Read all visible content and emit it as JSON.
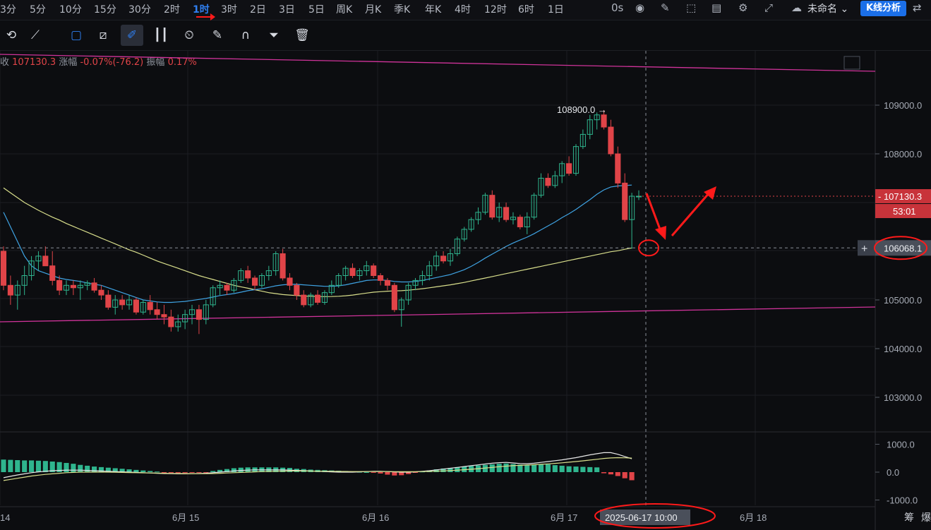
{
  "timeframes": [
    {
      "label": "3分",
      "active": false
    },
    {
      "label": "5分",
      "active": false
    },
    {
      "label": "10分",
      "active": false
    },
    {
      "label": "15分",
      "active": false
    },
    {
      "label": "30分",
      "active": false
    },
    {
      "label": "2时",
      "active": false
    },
    {
      "label": "1时",
      "active": true
    },
    {
      "label": "3时",
      "active": false
    },
    {
      "label": "2日",
      "active": false
    },
    {
      "label": "3日",
      "active": false
    },
    {
      "label": "5日",
      "active": false
    },
    {
      "label": "周K",
      "active": false
    },
    {
      "label": "月K",
      "active": false
    },
    {
      "label": "季K",
      "active": false
    },
    {
      "label": "年K",
      "active": false
    },
    {
      "label": "4时",
      "active": false
    },
    {
      "label": "12时",
      "active": false
    },
    {
      "label": "6时",
      "active": false
    },
    {
      "label": "1日",
      "active": false
    }
  ],
  "topbar": {
    "latency": "0s",
    "workspace": "未命名",
    "analysis_button": "K线分析"
  },
  "tools": [
    "sync-icon",
    "line-tool-icon",
    "rectangle-tool-icon",
    "ruler-icon",
    "brush-icon",
    "candles-icon",
    "timer-icon",
    "note-icon",
    "magnet-icon",
    "filter-icon",
    "trash-icon"
  ],
  "ohlc": {
    "close_label": "收",
    "close": "107130.3",
    "change_label": "涨幅",
    "change": "-0.07%(-76.2)",
    "amp_label": "振幅",
    "amp": "0.17%"
  },
  "price_axis": {
    "ticks": [
      "109000.0",
      "108000.0",
      "105000.0",
      "104000.0",
      "103000.0"
    ]
  },
  "last_price": {
    "value": "107130.3",
    "countdown": "53:01"
  },
  "crosshair_price": "106068.1",
  "crosshair_time": "2025-06-17 10:00",
  "high_marker": "108900.0 →",
  "indicator_axis": {
    "ticks": [
      "1000.0",
      "0.0",
      "-1000.0"
    ]
  },
  "x_axis": {
    "labels": [
      "14",
      "6月 15",
      "6月 16",
      "6月 17",
      "6月 18"
    ]
  },
  "bottom_right": [
    "筹",
    "爆"
  ],
  "colors": {
    "up": "#2fb58e",
    "down": "#e04448",
    "ma_fast": "#3fa3e3",
    "ma_slow": "#d9df8c",
    "channel": "#d0339a",
    "annotation": "#ff1a1a",
    "accent": "#2f7ff0"
  },
  "chart_data": {
    "type": "candlestick",
    "interval": "1h",
    "ylim": [
      102900,
      109900
    ],
    "x_labels": [
      "14",
      "6月 15",
      "6月 16",
      "6月 17",
      "6月 18"
    ],
    "candles": [
      [
        106000,
        106100,
        105200,
        105300
      ],
      [
        105300,
        105500,
        104900,
        105100
      ],
      [
        105100,
        105400,
        104800,
        105300
      ],
      [
        105300,
        105700,
        105100,
        105500
      ],
      [
        105500,
        105900,
        105400,
        105800
      ],
      [
        105800,
        106000,
        105600,
        105900
      ],
      [
        105900,
        106100,
        105700,
        105700
      ],
      [
        105700,
        106000,
        105300,
        105400
      ],
      [
        105400,
        105500,
        105100,
        105200
      ],
      [
        105200,
        105400,
        105100,
        105300
      ],
      [
        105300,
        105400,
        105100,
        105250
      ],
      [
        105250,
        105400,
        105000,
        105300
      ],
      [
        105300,
        105400,
        105200,
        105350
      ],
      [
        105350,
        105450,
        105150,
        105200
      ],
      [
        105200,
        105300,
        105000,
        105100
      ],
      [
        105100,
        105200,
        104800,
        104850
      ],
      [
        104850,
        105100,
        104700,
        105000
      ],
      [
        105000,
        105100,
        104800,
        104900
      ],
      [
        104900,
        105100,
        104800,
        105000
      ],
      [
        105000,
        105050,
        104700,
        104750
      ],
      [
        104750,
        105000,
        104700,
        104950
      ],
      [
        104950,
        105100,
        104700,
        104800
      ],
      [
        104800,
        104950,
        104600,
        104700
      ],
      [
        104700,
        104900,
        104500,
        104650
      ],
      [
        104650,
        104800,
        104350,
        104450
      ],
      [
        104450,
        104700,
        104350,
        104550
      ],
      [
        104550,
        104800,
        104400,
        104700
      ],
      [
        104700,
        104900,
        104500,
        104800
      ],
      [
        104800,
        104900,
        104300,
        104600
      ],
      [
        104600,
        105000,
        104500,
        104900
      ],
      [
        104900,
        105300,
        104850,
        105250
      ],
      [
        105250,
        105400,
        105100,
        105300
      ],
      [
        105300,
        105350,
        105100,
        105200
      ],
      [
        105200,
        105450,
        105150,
        105400
      ],
      [
        105400,
        105650,
        105350,
        105600
      ],
      [
        105600,
        105700,
        105350,
        105450
      ],
      [
        105450,
        105500,
        105200,
        105300
      ],
      [
        105300,
        105550,
        105250,
        105500
      ],
      [
        105500,
        105700,
        105400,
        105600
      ],
      [
        105600,
        106000,
        105500,
        105950
      ],
      [
        105950,
        106050,
        105400,
        105450
      ],
      [
        105450,
        105550,
        105200,
        105300
      ],
      [
        105300,
        105350,
        105000,
        105100
      ],
      [
        105100,
        105200,
        104850,
        104900
      ],
      [
        104900,
        105150,
        104850,
        105100
      ],
      [
        105100,
        105200,
        104900,
        104950
      ],
      [
        104950,
        105200,
        104900,
        105150
      ],
      [
        105150,
        105400,
        105100,
        105300
      ],
      [
        105300,
        105550,
        105250,
        105500
      ],
      [
        105500,
        105700,
        105400,
        105650
      ],
      [
        105650,
        105750,
        105450,
        105500
      ],
      [
        105500,
        105650,
        105400,
        105600
      ],
      [
        105600,
        105800,
        105500,
        105700
      ],
      [
        105700,
        105750,
        105450,
        105500
      ],
      [
        105500,
        105550,
        105300,
        105400
      ],
      [
        105400,
        105450,
        105200,
        105300
      ],
      [
        105300,
        105350,
        104750,
        104800
      ],
      [
        104800,
        105050,
        104450,
        105000
      ],
      [
        105000,
        105350,
        104900,
        105300
      ],
      [
        105300,
        105450,
        105200,
        105400
      ],
      [
        105400,
        105600,
        105300,
        105500
      ],
      [
        105500,
        105800,
        105400,
        105700
      ],
      [
        105700,
        106000,
        105600,
        105900
      ],
      [
        105900,
        106000,
        105750,
        105800
      ],
      [
        105800,
        106050,
        105700,
        105950
      ],
      [
        105950,
        106300,
        105900,
        106250
      ],
      [
        106250,
        106500,
        106200,
        106450
      ],
      [
        106450,
        106700,
        106400,
        106650
      ],
      [
        106650,
        106900,
        106550,
        106800
      ],
      [
        106800,
        107200,
        106750,
        107150
      ],
      [
        107150,
        107250,
        106650,
        106700
      ],
      [
        106700,
        107000,
        106600,
        106900
      ],
      [
        106900,
        107000,
        106600,
        106650
      ],
      [
        106650,
        106800,
        106550,
        106700
      ],
      [
        106700,
        106750,
        106450,
        106500
      ],
      [
        106500,
        106800,
        106350,
        106700
      ],
      [
        106700,
        107200,
        106650,
        107150
      ],
      [
        107150,
        107600,
        107100,
        107500
      ],
      [
        107500,
        107600,
        107300,
        107350
      ],
      [
        107350,
        107650,
        107300,
        107550
      ],
      [
        107550,
        107850,
        107400,
        107800
      ],
      [
        107800,
        107950,
        107550,
        107600
      ],
      [
        107600,
        108200,
        107550,
        108150
      ],
      [
        108150,
        108500,
        108100,
        108400
      ],
      [
        108400,
        108800,
        108300,
        108700
      ],
      [
        108700,
        108850,
        108500,
        108800
      ],
      [
        108800,
        108900,
        108500,
        108550
      ],
      [
        108550,
        108700,
        107950,
        108000
      ],
      [
        108000,
        108150,
        107300,
        107400
      ],
      [
        107400,
        107600,
        106600,
        106650
      ],
      [
        106650,
        107200,
        106050,
        107130
      ],
      [
        107130,
        107250,
        107050,
        107130
      ]
    ],
    "ma_fast": [
      106800,
      106500,
      106200,
      105900,
      105700,
      105600,
      105550,
      105500,
      105450,
      105420,
      105400,
      105380,
      105350,
      105320,
      105300,
      105250,
      105200,
      105150,
      105100,
      105050,
      105000,
      104980,
      104960,
      104950,
      104950,
      104960,
      104970,
      104990,
      105010,
      105030,
      105060,
      105090,
      105110,
      105130,
      105160,
      105190,
      105210,
      105230,
      105260,
      105290,
      105310,
      105320,
      105320,
      105310,
      105300,
      105290,
      105280,
      105280,
      105290,
      105310,
      105340,
      105370,
      105400,
      105410,
      105410,
      105400,
      105380,
      105370,
      105370,
      105380,
      105400,
      105430,
      105460,
      105490,
      105520,
      105570,
      105620,
      105690,
      105770,
      105860,
      105940,
      106020,
      106100,
      106170,
      106230,
      106290,
      106360,
      106440,
      106520,
      106600,
      106690,
      106770,
      106860,
      106960,
      107060,
      107170,
      107260,
      107320,
      107340,
      107350,
      107360
    ],
    "ma_slow": [
      107300,
      107200,
      107100,
      107000,
      106920,
      106840,
      106770,
      106700,
      106640,
      106570,
      106510,
      106450,
      106390,
      106330,
      106270,
      106210,
      106150,
      106090,
      106030,
      105980,
      105920,
      105860,
      105800,
      105750,
      105700,
      105650,
      105600,
      105550,
      105500,
      105460,
      105420,
      105380,
      105340,
      105300,
      105270,
      105240,
      105210,
      105180,
      105150,
      105130,
      105110,
      105100,
      105090,
      105080,
      105075,
      105070,
      105068,
      105070,
      105075,
      105085,
      105100,
      105120,
      105140,
      105160,
      105170,
      105180,
      105185,
      105190,
      105200,
      105215,
      105230,
      105250,
      105270,
      105290,
      105310,
      105335,
      105360,
      105390,
      105420,
      105450,
      105480,
      105510,
      105540,
      105570,
      105600,
      105630,
      105660,
      105690,
      105720,
      105750,
      105780,
      105810,
      105840,
      105870,
      105900,
      105930,
      105960,
      105990,
      106010,
      106040,
      106068
    ],
    "indicator": {
      "ylim": [
        -1000,
        1000
      ],
      "hist": [
        450,
        440,
        430,
        420,
        420,
        410,
        400,
        380,
        360,
        330,
        300,
        260,
        230,
        200,
        180,
        160,
        140,
        120,
        100,
        80,
        60,
        40,
        20,
        -20,
        -30,
        -30,
        -30,
        -20,
        -20,
        -10,
        40,
        80,
        110,
        140,
        160,
        170,
        170,
        170,
        170,
        170,
        160,
        150,
        120,
        110,
        90,
        80,
        70,
        60,
        50,
        40,
        20,
        10,
        0,
        -20,
        -50,
        -90,
        -120,
        -110,
        -70,
        -20,
        20,
        60,
        100,
        130,
        150,
        180,
        200,
        220,
        240,
        260,
        280,
        300,
        310,
        290,
        270,
        250,
        260,
        270,
        280,
        250,
        230,
        210,
        200,
        190,
        180,
        170,
        -40,
        -80,
        -140,
        -220,
        -290
      ],
      "line1": [
        -200,
        -150,
        -100,
        -60,
        -20,
        10,
        30,
        50,
        60,
        70,
        70,
        70,
        60,
        50,
        40,
        30,
        20,
        10,
        0,
        -10,
        -20,
        -30,
        -40,
        -50,
        -55,
        -60,
        -60,
        -55,
        -50,
        -40,
        -20,
        0,
        20,
        40,
        60,
        70,
        80,
        80,
        80,
        80,
        80,
        70,
        60,
        50,
        40,
        30,
        20,
        10,
        0,
        0,
        0,
        10,
        20,
        30,
        30,
        20,
        10,
        0,
        0,
        10,
        30,
        50,
        80,
        110,
        140,
        170,
        200,
        230,
        260,
        290,
        320,
        340,
        350,
        330,
        310,
        300,
        320,
        350,
        380,
        410,
        440,
        480,
        520,
        570,
        620,
        660,
        700,
        700,
        640,
        560,
        480
      ],
      "line2": [
        -300,
        -260,
        -220,
        -180,
        -140,
        -110,
        -80,
        -60,
        -40,
        -20,
        -10,
        0,
        0,
        0,
        0,
        0,
        -5,
        -10,
        -15,
        -20,
        -25,
        -30,
        -35,
        -40,
        -45,
        -50,
        -52,
        -54,
        -55,
        -55,
        -50,
        -40,
        -30,
        -20,
        -10,
        0,
        10,
        20,
        25,
        30,
        35,
        40,
        40,
        40,
        38,
        36,
        34,
        30,
        26,
        22,
        20,
        20,
        20,
        20,
        20,
        20,
        18,
        16,
        15,
        15,
        20,
        26,
        34,
        44,
        56,
        70,
        86,
        104,
        124,
        146,
        170,
        194,
        216,
        232,
        244,
        254,
        266,
        280,
        296,
        314,
        334,
        356,
        380,
        406,
        432,
        460,
        490,
        510,
        520,
        515,
        505
      ]
    }
  }
}
